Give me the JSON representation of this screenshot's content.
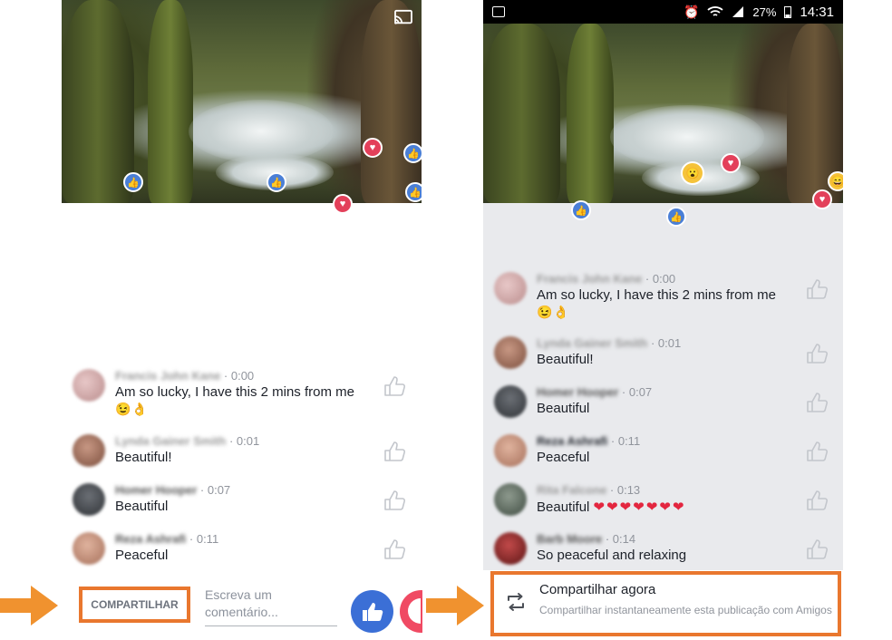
{
  "left_panel": {
    "comments": [
      {
        "name": "Francis John Kane",
        "time": " · 0:00",
        "text": "Am so lucky, I have this 2 mins from me",
        "emoji": "😉👌"
      },
      {
        "name": "Lynda Gainer Smith",
        "time": " · 0:01",
        "text": "Beautiful!"
      },
      {
        "name": "Homer Hooper",
        "time": " · 0:07",
        "text": "Beautiful"
      },
      {
        "name": "Reza Ashrafi",
        "time": " · 0:11",
        "text": "Peaceful"
      }
    ],
    "share_button_label": "COMPARTILHAR",
    "comment_input_placeholder": "Escreva um comentário..."
  },
  "right_panel": {
    "status_bar": {
      "battery": "27%",
      "time": "14:31"
    },
    "comments": [
      {
        "name": "Francis John Kane",
        "time": " · 0:00",
        "text": "Am so lucky, I have this 2 mins from me",
        "emoji": "😉👌"
      },
      {
        "name": "Lynda Gainer Smith",
        "time": " · 0:01",
        "text": "Beautiful!"
      },
      {
        "name": "Homer Hooper",
        "time": " · 0:07",
        "text": "Beautiful"
      },
      {
        "name": "Reza Ashrafi",
        "time": " · 0:11",
        "text": "Peaceful"
      },
      {
        "name": "Rita Falcone",
        "time": " · 0:13",
        "text": "Beautiful",
        "hearts": "❤❤❤❤❤❤❤"
      },
      {
        "name": "Barb Moore",
        "time": " · 0:14",
        "text": "So peaceful and relaxing"
      }
    ],
    "share_now": {
      "title": "Compartilhar agora",
      "subtitle": "Compartilhar instantaneamente esta publicação com Amigos"
    }
  },
  "colors": {
    "highlight_orange": "#e9772e",
    "facebook_blue": "#3b6fd6",
    "love_red": "#f04a63"
  },
  "icons": [
    "cast-icon",
    "like-reaction-icon",
    "love-reaction-icon",
    "wow-reaction-icon",
    "thumbs-up-icon",
    "share-icon",
    "arrow-right-icon",
    "gallery-icon",
    "alarm-icon",
    "wifi-icon",
    "signal-icon"
  ]
}
